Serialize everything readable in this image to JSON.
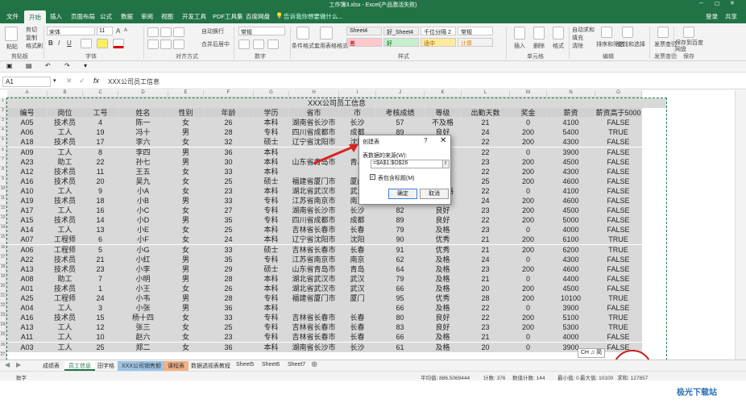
{
  "window": {
    "title": "工作簿3.xlsx - Excel(产品激活失败)",
    "user": "登录",
    "share": "共享"
  },
  "tabs": [
    "文件",
    "开始",
    "插入",
    "页面布局",
    "公式",
    "数据",
    "审阅",
    "视图",
    "开发工具",
    "PDF工具集",
    "百度网盘"
  ],
  "active_tab": "开始",
  "tell_me": "告诉我你想要做什么...",
  "ribbon": {
    "clipboard": {
      "label": "剪贴板",
      "paste": "粘贴",
      "cut": "剪切",
      "copy": "复制",
      "format_painter": "格式刷"
    },
    "font": {
      "label": "字体",
      "font_name": "宋体",
      "font_size": "11",
      "bold": "B",
      "italic": "I",
      "underline": "U",
      "grow": "A",
      "shrink": "A"
    },
    "alignment": {
      "label": "对齐方式",
      "wrap": "自动换行",
      "merge": "合并后居中"
    },
    "number": {
      "label": "数字",
      "format": "常规"
    },
    "styles": {
      "label": "样式",
      "conditional": "条件格式",
      "table": "套用表格格式",
      "cell_styles": [
        "Sheet4",
        "好_Sheet4",
        "千位分隔 2",
        "常规",
        "差",
        "好",
        "适中",
        "计算"
      ]
    },
    "cells": {
      "label": "单元格",
      "insert": "插入",
      "delete": "删除",
      "format": "格式"
    },
    "editing": {
      "label": "编辑",
      "autosum": "自动求和",
      "fill": "填充",
      "clear": "清除",
      "sort": "排序和筛选",
      "find": "查找和选择"
    },
    "invoice": {
      "label": "发票查验",
      "btn": "发票查验"
    },
    "save": {
      "label": "保存",
      "btn": "保存到百度网盘"
    }
  },
  "formula_bar": {
    "name_box": "A1",
    "fx": "fx",
    "formula": "XXX公司员工信息"
  },
  "columns": [
    "A",
    "B",
    "C",
    "D",
    "E",
    "F",
    "G",
    "H",
    "I",
    "J",
    "K",
    "L",
    "M",
    "N",
    "O"
  ],
  "row_numbers": [
    "1",
    "2",
    "3",
    "4",
    "5",
    "6",
    "7",
    "8",
    "9",
    "10",
    "11",
    "12",
    "13",
    "14",
    "15",
    "16",
    "17",
    "18",
    "19",
    "20",
    "21",
    "22",
    "23",
    "24",
    "25",
    "26",
    "27",
    "28"
  ],
  "table": {
    "title": "XXX公司员工信息",
    "headers": [
      "编号",
      "岗位",
      "工号",
      "姓名",
      "性别",
      "年龄",
      "学历",
      "省市",
      "市",
      "考核成绩",
      "等级",
      "出勤天数",
      "奖金",
      "薪资",
      "薪资高于5000"
    ],
    "rows": [
      [
        "A05",
        "技术员",
        "4",
        "陈一",
        "女",
        "26",
        "本科",
        "湖南省长沙市",
        "长沙",
        "57",
        "不及格",
        "21",
        "0",
        "4100",
        "FALSE"
      ],
      [
        "A06",
        "工人",
        "19",
        "冯十",
        "男",
        "28",
        "专科",
        "四川省成都市",
        "成都",
        "89",
        "良好",
        "24",
        "200",
        "5400",
        "TRUE"
      ],
      [
        "A18",
        "技术员",
        "17",
        "李六",
        "女",
        "32",
        "硕士",
        "辽宁省沈阳市",
        "沈阳",
        "65",
        "及格",
        "22",
        "200",
        "4300",
        "FALSE"
      ],
      [
        "A09",
        "工人",
        "8",
        "李四",
        "男",
        "36",
        "本科",
        "",
        "",
        "66",
        "及格",
        "22",
        "0",
        "3900",
        "FALSE"
      ],
      [
        "A23",
        "助工",
        "22",
        "孙七",
        "男",
        "30",
        "本科",
        "山东省青岛市",
        "青岛",
        "78",
        "及格",
        "23",
        "200",
        "4500",
        "FALSE"
      ],
      [
        "A12",
        "技术员",
        "11",
        "王五",
        "女",
        "33",
        "本科",
        "",
        "",
        "63",
        "及格",
        "22",
        "200",
        "4300",
        "FALSE"
      ],
      [
        "A16",
        "技术员",
        "20",
        "吴九",
        "女",
        "25",
        "硕士",
        "福建省厦门市",
        "厦门",
        "65",
        "及格",
        "25",
        "200",
        "4600",
        "FALSE"
      ],
      [
        "A10",
        "工人",
        "9",
        "小A",
        "女",
        "23",
        "本科",
        "湖北省武汉市",
        "武汉",
        "58",
        "不及格",
        "22",
        "0",
        "4100",
        "FALSE"
      ],
      [
        "A19",
        "技术员",
        "18",
        "小B",
        "男",
        "33",
        "专科",
        "江苏省南京市",
        "南京",
        "66",
        "及格",
        "24",
        "200",
        "4600",
        "FALSE"
      ],
      [
        "A17",
        "工人",
        "16",
        "小C",
        "女",
        "27",
        "专科",
        "湖南省长沙市",
        "长沙",
        "82",
        "良好",
        "23",
        "200",
        "4500",
        "FALSE"
      ],
      [
        "A15",
        "技术员",
        "14",
        "小D",
        "男",
        "35",
        "专科",
        "四川省成都市",
        "成都",
        "89",
        "良好",
        "22",
        "200",
        "5000",
        "FALSE"
      ],
      [
        "A14",
        "工人",
        "13",
        "小E",
        "女",
        "25",
        "本科",
        "吉林省长春市",
        "长春",
        "79",
        "及格",
        "23",
        "0",
        "4000",
        "FALSE"
      ],
      [
        "A07",
        "工程师",
        "6",
        "小F",
        "女",
        "24",
        "本科",
        "辽宁省沈阳市",
        "沈阳",
        "90",
        "优秀",
        "21",
        "200",
        "6100",
        "TRUE"
      ],
      [
        "A06",
        "工程师",
        "5",
        "小G",
        "女",
        "33",
        "硕士",
        "吉林省长春市",
        "长春",
        "91",
        "优秀",
        "21",
        "200",
        "6200",
        "TRUE"
      ],
      [
        "A22",
        "技术员",
        "21",
        "小红",
        "男",
        "35",
        "专科",
        "江苏省南京市",
        "南京",
        "62",
        "及格",
        "24",
        "0",
        "4300",
        "FALSE"
      ],
      [
        "A13",
        "技术员",
        "23",
        "小李",
        "男",
        "29",
        "硕士",
        "山东省青岛市",
        "青岛",
        "64",
        "及格",
        "23",
        "200",
        "4600",
        "FALSE"
      ],
      [
        "A08",
        "助工",
        "7",
        "小明",
        "男",
        "28",
        "本科",
        "湖北省武汉市",
        "武汉",
        "79",
        "及格",
        "21",
        "0",
        "4400",
        "FALSE"
      ],
      [
        "A01",
        "技术员",
        "1",
        "小王",
        "女",
        "26",
        "本科",
        "湖北省武汉市",
        "武汉",
        "66",
        "及格",
        "20",
        "200",
        "4500",
        "FALSE"
      ],
      [
        "A25",
        "工程师",
        "24",
        "小韦",
        "男",
        "28",
        "专科",
        "福建省厦门市",
        "厦门",
        "95",
        "优秀",
        "28",
        "200",
        "10100",
        "TRUE"
      ],
      [
        "A04",
        "工人",
        "3",
        "小张",
        "男",
        "36",
        "本科",
        "",
        "",
        "66",
        "及格",
        "22",
        "0",
        "3900",
        "FALSE"
      ],
      [
        "A16",
        "技术员",
        "15",
        "杨十四",
        "女",
        "33",
        "专科",
        "吉林省长春市",
        "长春",
        "80",
        "良好",
        "22",
        "200",
        "5100",
        "TRUE"
      ],
      [
        "A13",
        "工人",
        "12",
        "张三",
        "女",
        "25",
        "专科",
        "吉林省长春市",
        "长春",
        "83",
        "良好",
        "23",
        "200",
        "5300",
        "TRUE"
      ],
      [
        "A11",
        "工人",
        "10",
        "赵六",
        "女",
        "23",
        "专科",
        "吉林省长春市",
        "长春",
        "66",
        "及格",
        "21",
        "0",
        "4000",
        "FALSE"
      ],
      [
        "A03",
        "工人",
        "25",
        "郑二",
        "女",
        "36",
        "本科",
        "湖南省长沙市",
        "长沙",
        "61",
        "及格",
        "20",
        "0",
        "3900",
        "FALSE"
      ]
    ]
  },
  "dialog": {
    "title": "创建表",
    "help": "?",
    "close": "✕",
    "prompt": "表数据的来源(W):",
    "range": "=$A$1:$O$26",
    "range_btn": "⇧",
    "checkbox_label": "表包含标题(M)",
    "checked": "✓",
    "ok": "确定",
    "cancel": "取消"
  },
  "sheet_tabs": [
    "成绩表",
    "员工信息",
    "田字格",
    "XXX公司销售额",
    "课程表",
    "数据透视表教程",
    "Sheet5",
    "Sheet6",
    "Sheet7"
  ],
  "active_sheet": "员工信息",
  "ch_button": "CH ♫ 简",
  "status": {
    "mode": "数字",
    "average": "平均值: 886.5069444",
    "count": "计数: 376",
    "numeric_count": "数值计数: 144",
    "min": "最小值: 0",
    "max": "最大值: 10100",
    "sum": "求和: 127657"
  },
  "stamp_glyph": "★",
  "watermark": "极光下载站"
}
